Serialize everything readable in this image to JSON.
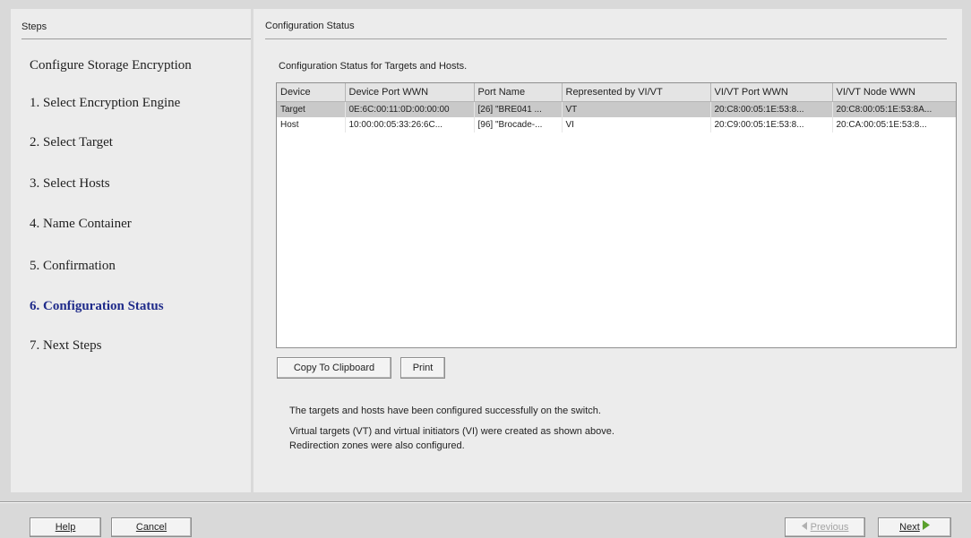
{
  "steps": {
    "header": "Steps",
    "items": [
      "Configure Storage Encryption",
      "1. Select Encryption Engine",
      "2. Select Target",
      "3. Select Hosts",
      "4. Name Container",
      "5. Confirmation",
      "6. Configuration Status",
      "7. Next Steps"
    ],
    "active_index": 6
  },
  "config": {
    "header": "Configuration Status",
    "subtitle": "Configuration Status for Targets and Hosts.",
    "table": {
      "columns": [
        "Device",
        "Device Port WWN",
        "Port Name",
        "Represented by VI/VT",
        "VI/VT Port WWN",
        "VI/VT Node WWN"
      ],
      "rows": [
        [
          "Target",
          "0E:6C:00:11:0D:00:00:00",
          "[26] \"BRE041 ...",
          "VT",
          "20:C8:00:05:1E:53:8...",
          "20:C8:00:05:1E:53:8A..."
        ],
        [
          "Host",
          "10:00:00:05:33:26:6C...",
          "[96] \"Brocade-...",
          "VI",
          "20:C9:00:05:1E:53:8...",
          "20:CA:00:05:1E:53:8..."
        ]
      ],
      "selected_row": 0
    },
    "buttons": {
      "copy": "Copy To Clipboard",
      "print": "Print"
    },
    "messages": [
      "The targets and hosts have been configured successfully on the switch.",
      "Virtual targets (VT) and virtual initiators (VI) were created as shown above.",
      "Redirection zones were also configured."
    ]
  },
  "footer": {
    "help": "Help",
    "cancel": "Cancel",
    "previous": "Previous",
    "next": "Next"
  },
  "colors": {
    "active_step": "#1f2b8a",
    "next_arrow": "#5aa02c",
    "prev_arrow": "#b0b0b0"
  }
}
